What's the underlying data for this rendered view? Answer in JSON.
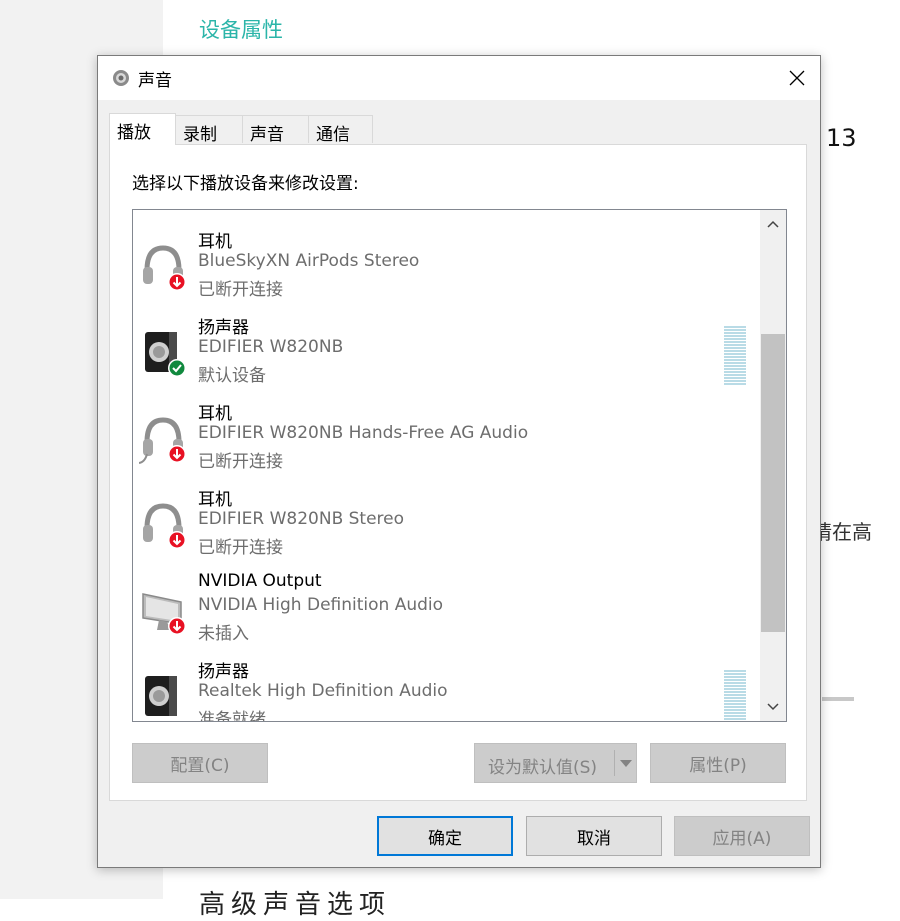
{
  "background": {
    "section_title": "设备属性",
    "fragment_13": "13",
    "fragment_text": "请在高",
    "bottom_text": "高级声音选项"
  },
  "dialog": {
    "title": "声音",
    "tabs": [
      {
        "label": "播放",
        "active": true
      },
      {
        "label": "录制",
        "active": false
      },
      {
        "label": "声音",
        "active": false
      },
      {
        "label": "通信",
        "active": false
      }
    ],
    "instruction": "选择以下播放设备来修改设置:",
    "devices": [
      {
        "name": "耳机",
        "description": "BlueSkyXN AirPods Stereo",
        "status": "已断开连接",
        "icon": "headphones-icon",
        "badge": "disconnected-badge-icon",
        "level_meter": false
      },
      {
        "name": "扬声器",
        "description": "EDIFIER W820NB",
        "status": "默认设备",
        "icon": "speaker-icon",
        "badge": "default-check-badge-icon",
        "level_meter": true
      },
      {
        "name": "耳机",
        "description": "EDIFIER W820NB Hands-Free AG Audio",
        "status": "已断开连接",
        "icon": "headset-icon",
        "badge": "disconnected-badge-icon",
        "level_meter": false
      },
      {
        "name": "耳机",
        "description": "EDIFIER W820NB Stereo",
        "status": "已断开连接",
        "icon": "headphones-icon",
        "badge": "disconnected-badge-icon",
        "level_meter": false
      },
      {
        "name": "NVIDIA Output",
        "description": "NVIDIA High Definition Audio",
        "status": "未插入",
        "icon": "monitor-icon",
        "badge": "disconnected-badge-icon",
        "level_meter": false
      },
      {
        "name": "扬声器",
        "description": "Realtek High Definition Audio",
        "status": "准备就绪",
        "icon": "speaker-icon",
        "badge": "",
        "level_meter": true
      }
    ],
    "buttons": {
      "configure": "配置(C)",
      "set_default": "设为默认值(S)",
      "properties": "属性(P)",
      "ok": "确定",
      "cancel": "取消",
      "apply": "应用(A)"
    }
  },
  "colors": {
    "accent": "#0078d7",
    "teal_heading": "#2bb5a9",
    "badge_red": "#e81123",
    "badge_green": "#10893e",
    "meter": "#b9dbe6"
  }
}
